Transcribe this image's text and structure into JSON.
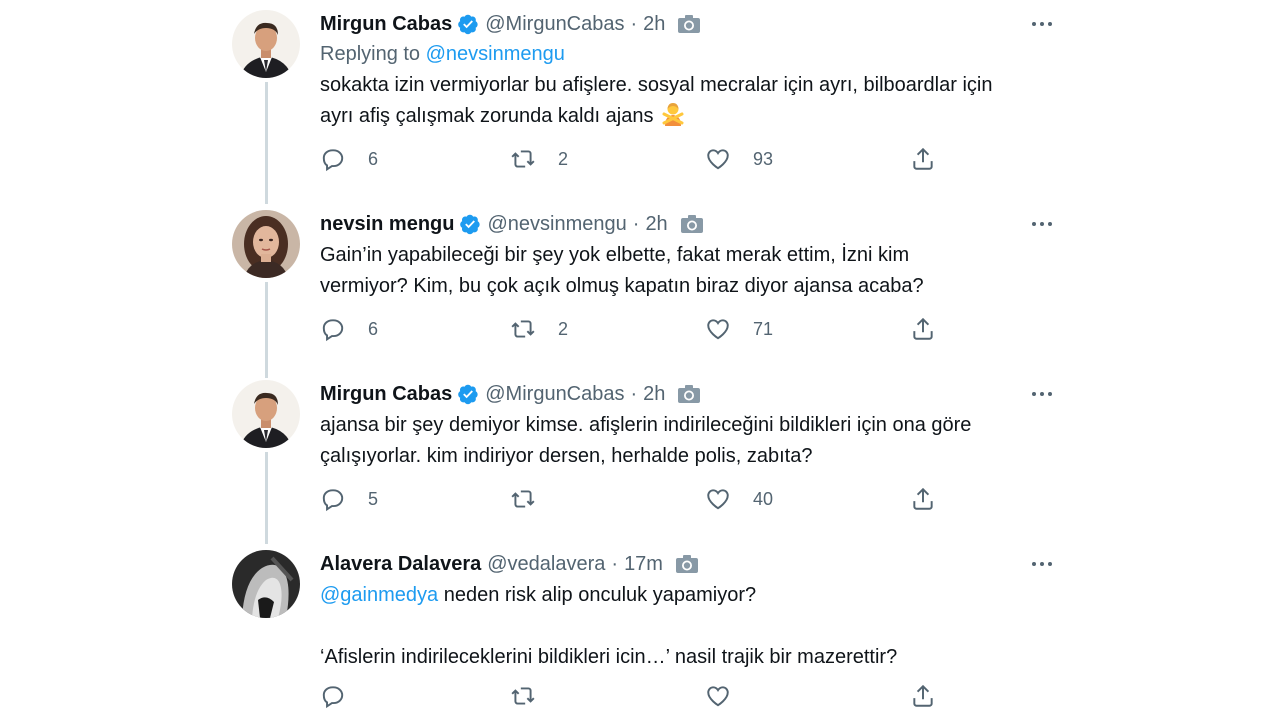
{
  "tweets": [
    {
      "name": "Mirgun Cabas",
      "handle": "@MirgunCabas",
      "time": "2h",
      "reply_prefix": "Replying to ",
      "reply_mention": "@nevsinmengu",
      "line1": "sokakta izin vermiyorlar bu afişlere. sosyal mecralar için ayrı, bilboardlar için",
      "line2": "ayrı afiş  çalışmak zorunda kaldı ajans",
      "replies": "6",
      "retweets": "2",
      "likes": "93"
    },
    {
      "name": "nevsin mengu",
      "handle": "@nevsinmengu",
      "time": "2h",
      "line1": "Gain’in yapabileceği bir şey yok elbette, fakat merak ettim, İzni kim",
      "line2": "vermiyor? Kim, bu çok açık olmuş kapatın biraz diyor ajansa acaba?",
      "replies": "6",
      "retweets": "2",
      "likes": "71"
    },
    {
      "name": "Mirgun Cabas",
      "handle": "@MirgunCabas",
      "time": "2h",
      "line1": "ajansa bir şey demiyor kimse. afişlerin indirileceğini bildikleri için ona göre",
      "line2": "çalışıyorlar. kim indiriyor dersen, herhalde polis, zabıta?",
      "replies": "5",
      "retweets": "",
      "likes": "40"
    },
    {
      "name": "Alavera Dalavera",
      "handle": "@vedalavera",
      "time": "17m",
      "mention": "@gainmedya",
      "line1_rest": " neden risk alip onculuk yapamiyor?",
      "line2": "‘Afislerin indirileceklerini bildikleri icin…’ nasil trajik bir mazerettir?",
      "replies": "",
      "retweets": "",
      "likes": ""
    }
  ],
  "separator": "·",
  "colors": {
    "accent": "#1d9bf0",
    "secondary": "#536471",
    "thread_line": "#cfd9de"
  },
  "icons": [
    "verified-badge-icon",
    "camera-icon",
    "more-icon",
    "reply-icon",
    "retweet-icon",
    "like-icon",
    "share-icon",
    "person-gesturing-no-emoji"
  ]
}
